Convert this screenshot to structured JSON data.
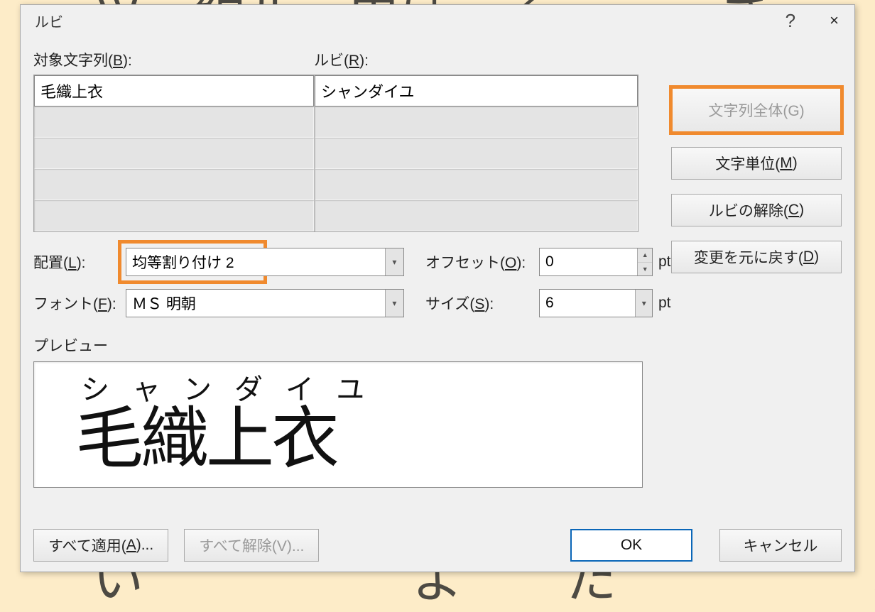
{
  "dialog": {
    "title": "ルビ",
    "help": "?",
    "close": "×"
  },
  "labels": {
    "target": "対象文字列(B):",
    "ruby": "ルビ(R):",
    "alignment": "配置(L):",
    "font": "フォント(F):",
    "offset": "オフセット(O):",
    "size": "サイズ(S):",
    "preview": "プレビュー",
    "pt": "pt"
  },
  "fields": {
    "target_value": "毛織上衣",
    "ruby_value": "シャンダイユ",
    "alignment_value": "均等割り付け 2",
    "font_value": "ＭＳ 明朝",
    "offset_value": "0",
    "size_value": "6"
  },
  "buttons": {
    "group_whole": "文字列全体(G)",
    "group_char": "文字単位(M)",
    "remove_ruby": "ルビの解除(C)",
    "restore": "変更を元に戻す(D)",
    "apply_all": "すべて適用(A)...",
    "remove_all": "すべて解除(V)...",
    "ok": "OK",
    "cancel": "キャンセル"
  },
  "preview": {
    "ruby_text": "シャンダイユ",
    "base_text": "毛織上衣"
  }
}
